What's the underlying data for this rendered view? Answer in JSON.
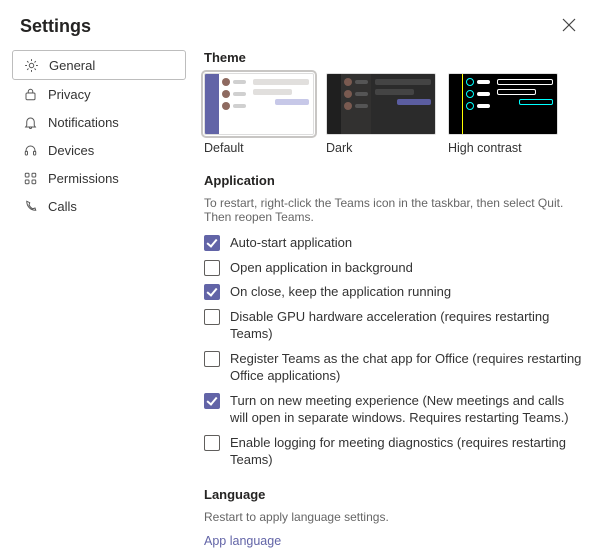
{
  "header": {
    "title": "Settings",
    "close_icon": "close-icon"
  },
  "sidebar": {
    "items": [
      {
        "label": "General",
        "active": true
      },
      {
        "label": "Privacy",
        "active": false
      },
      {
        "label": "Notifications",
        "active": false
      },
      {
        "label": "Devices",
        "active": false
      },
      {
        "label": "Permissions",
        "active": false
      },
      {
        "label": "Calls",
        "active": false
      }
    ]
  },
  "theme": {
    "section_title": "Theme",
    "options": [
      {
        "label": "Default",
        "selected": true
      },
      {
        "label": "Dark",
        "selected": false
      },
      {
        "label": "High contrast",
        "selected": false
      }
    ]
  },
  "application": {
    "section_title": "Application",
    "hint": "To restart, right-click the Teams icon in the taskbar, then select Quit. Then reopen Teams.",
    "options": [
      {
        "label": "Auto-start application",
        "checked": true
      },
      {
        "label": "Open application in background",
        "checked": false
      },
      {
        "label": "On close, keep the application running",
        "checked": true
      },
      {
        "label": "Disable GPU hardware acceleration (requires restarting Teams)",
        "checked": false
      },
      {
        "label": "Register Teams as the chat app for Office (requires restarting Office applications)",
        "checked": false
      },
      {
        "label": "Turn on new meeting experience (New meetings and calls will open in separate windows. Requires restarting Teams.)",
        "checked": true
      },
      {
        "label": "Enable logging for meeting diagnostics (requires restarting Teams)",
        "checked": false
      }
    ]
  },
  "language": {
    "section_title": "Language",
    "hint": "Restart to apply language settings.",
    "app_language_label": "App language"
  }
}
